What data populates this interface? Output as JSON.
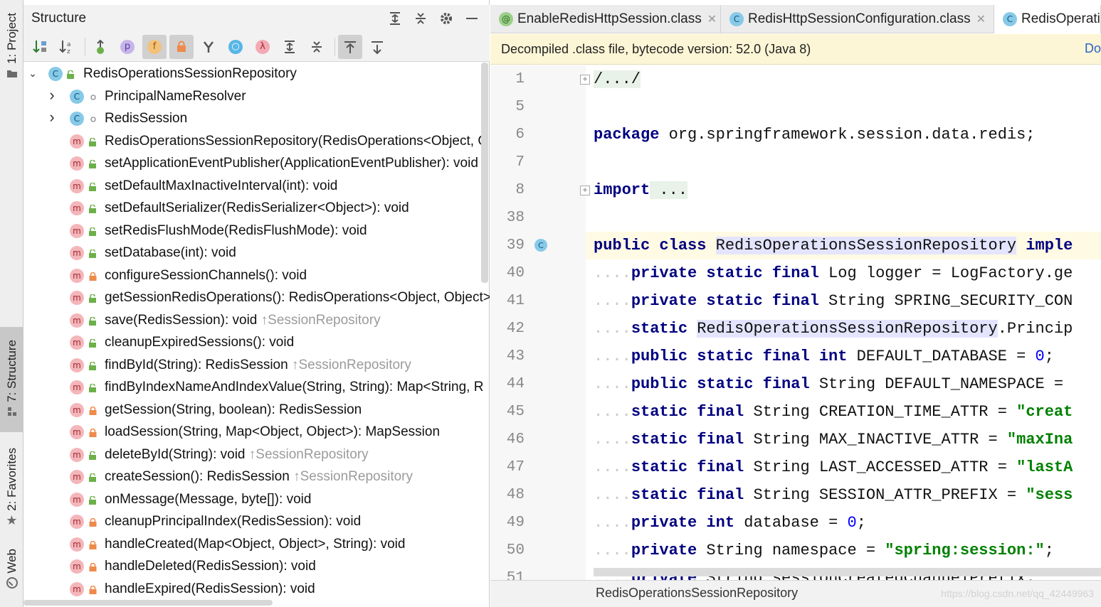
{
  "left_toolbar": {
    "project_tab": "1: Project",
    "structure_tab": "7: Structure",
    "favorites_tab": "2: Favorites",
    "web_tab": "Web"
  },
  "structure_panel": {
    "title": "Structure",
    "tree": {
      "root": "RedisOperationsSessionRepository",
      "inner_classes": [
        "PrincipalNameResolver",
        "RedisSession"
      ],
      "members": [
        {
          "text": "RedisOperationsSessionRepository(RedisOperations<Object, O",
          "inherited": "",
          "access": "public"
        },
        {
          "text": "setApplicationEventPublisher(ApplicationEventPublisher): void",
          "inherited": "",
          "access": "public"
        },
        {
          "text": "setDefaultMaxInactiveInterval(int): void",
          "inherited": "",
          "access": "public"
        },
        {
          "text": "setDefaultSerializer(RedisSerializer<Object>): void",
          "inherited": "",
          "access": "public"
        },
        {
          "text": "setRedisFlushMode(RedisFlushMode): void",
          "inherited": "",
          "access": "public"
        },
        {
          "text": "setDatabase(int): void",
          "inherited": "",
          "access": "public"
        },
        {
          "text": "configureSessionChannels(): void",
          "inherited": "",
          "access": "private"
        },
        {
          "text": "getSessionRedisOperations(): RedisOperations<Object, Object>",
          "inherited": "",
          "access": "public"
        },
        {
          "text": "save(RedisSession): void ",
          "inherited": "↑SessionRepository",
          "access": "public"
        },
        {
          "text": "cleanupExpiredSessions(): void",
          "inherited": "",
          "access": "public"
        },
        {
          "text": "findById(String): RedisSession ",
          "inherited": "↑SessionRepository",
          "access": "public"
        },
        {
          "text": "findByIndexNameAndIndexValue(String, String): Map<String, R",
          "inherited": "",
          "access": "public"
        },
        {
          "text": "getSession(String, boolean): RedisSession",
          "inherited": "",
          "access": "private"
        },
        {
          "text": "loadSession(String, Map<Object, Object>): MapSession",
          "inherited": "",
          "access": "private"
        },
        {
          "text": "deleteById(String): void ",
          "inherited": "↑SessionRepository",
          "access": "public"
        },
        {
          "text": "createSession(): RedisSession ",
          "inherited": "↑SessionRepository",
          "access": "public"
        },
        {
          "text": "onMessage(Message, byte[]): void",
          "inherited": "",
          "access": "public"
        },
        {
          "text": "cleanupPrincipalIndex(RedisSession): void",
          "inherited": "",
          "access": "private"
        },
        {
          "text": "handleCreated(Map<Object, Object>, String): void",
          "inherited": "",
          "access": "private"
        },
        {
          "text": "handleDeleted(RedisSession): void",
          "inherited": "",
          "access": "private"
        },
        {
          "text": "handleExpired(RedisSession): void",
          "inherited": "",
          "access": "private"
        }
      ]
    }
  },
  "editor": {
    "tabs": [
      {
        "label": "EnableRedisHttpSession.class",
        "icon": "annotation-icon",
        "active": false
      },
      {
        "label": "RedisHttpSessionConfiguration.class",
        "icon": "class-icon",
        "active": false
      },
      {
        "label": "RedisOperati",
        "icon": "class-icon",
        "active": true
      }
    ],
    "banner": {
      "text": "Decompiled .class file, bytecode version: 52.0 (Java 8)",
      "link": "Do"
    },
    "line_numbers": [
      "1",
      "5",
      "6",
      "7",
      "8",
      "38",
      "39",
      "40",
      "41",
      "42",
      "43",
      "44",
      "45",
      "46",
      "47",
      "48",
      "49",
      "50",
      "51"
    ],
    "code": {
      "l1": "/.../",
      "l6_kw": "package",
      "l6_rest": " org.springframework.session.data.redis;",
      "l8_kw": "import",
      "l8_rest": " ...",
      "l39_kw": "public class",
      "l39_name": "RedisOperationsSessionRepository",
      "l39_tail": " imple",
      "l40": {
        "kw": "private static final",
        "rest": " Log logger = LogFactory.ge"
      },
      "l41": {
        "kw": "private static final",
        "rest": " String SPRING_SECURITY_CON"
      },
      "l42": {
        "kw": "static",
        "name": "RedisOperationsSessionRepository",
        "rest": ".Princip"
      },
      "l43": {
        "kw": "public static final int",
        "rest": " DEFAULT_DATABASE = ",
        "num": "0",
        "end": ";"
      },
      "l44": {
        "kw": "public static final",
        "rest": " String DEFAULT_NAMESPACE = "
      },
      "l45": {
        "kw": "static final",
        "rest": " String CREATION_TIME_ATTR = ",
        "str": "\"creat"
      },
      "l46": {
        "kw": "static final",
        "rest": " String MAX_INACTIVE_ATTR = ",
        "str": "\"maxIna"
      },
      "l47": {
        "kw": "static final",
        "rest": " String LAST_ACCESSED_ATTR = ",
        "str": "\"lastA"
      },
      "l48": {
        "kw": "static final",
        "rest": " String SESSION_ATTR_PREFIX = ",
        "str": "\"sess"
      },
      "l49": {
        "kw": "private int",
        "rest": " database = ",
        "num": "0",
        "end": ";"
      },
      "l50": {
        "kw": "private",
        "rest": " String namespace = ",
        "str": "\"spring:session:\"",
        "end": ";"
      },
      "l51": {
        "kw": "private",
        "rest": " String sessionCreatedChannelPrefix;"
      },
      "indent": "...."
    },
    "breadcrumb": "RedisOperationsSessionRepository",
    "watermark": "https://blog.csdn.net/qq_42449963"
  },
  "colors": {
    "keyword": "#000080",
    "string": "#008000",
    "number": "#0000ff",
    "banner_bg": "#fdf6d6",
    "selection_bg": "#e4e4ff"
  }
}
